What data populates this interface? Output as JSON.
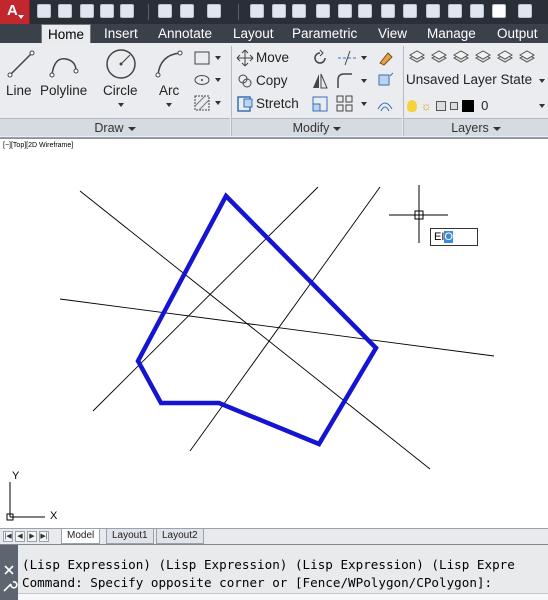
{
  "app": {
    "logo_letter": "A"
  },
  "tabs": [
    {
      "label": "Home",
      "active": true
    },
    {
      "label": "Insert",
      "active": false
    },
    {
      "label": "Annotate",
      "active": false
    },
    {
      "label": "Layout",
      "active": false
    },
    {
      "label": "Parametric",
      "active": false
    },
    {
      "label": "View",
      "active": false
    },
    {
      "label": "Manage",
      "active": false
    },
    {
      "label": "Output",
      "active": false
    }
  ],
  "draw_panel": {
    "title": "Draw",
    "tools": [
      {
        "label": "Line",
        "icon": "line-icon"
      },
      {
        "label": "Polyline",
        "icon": "polyline-icon"
      },
      {
        "label": "Circle",
        "icon": "circle-icon"
      },
      {
        "label": "Arc",
        "icon": "arc-icon"
      }
    ]
  },
  "modify_panel": {
    "title": "Modify",
    "tools": [
      {
        "label": "Move",
        "icon": "move-icon"
      },
      {
        "label": "Copy",
        "icon": "copy-icon"
      },
      {
        "label": "Stretch",
        "icon": "stretch-icon"
      }
    ]
  },
  "layers_panel": {
    "title": "Layers",
    "layer_state": "Unsaved Layer State",
    "current_layer": "0"
  },
  "viewport": {
    "label": "[−][Top][2D Wireframe]",
    "dynamic_input": "EI",
    "dynamic_input_selected": "O"
  },
  "layout_tabs": [
    {
      "label": "Model",
      "active": true
    },
    {
      "label": "Layout1",
      "active": false
    },
    {
      "label": "Layout2",
      "active": false
    }
  ],
  "command": {
    "history": "(Lisp Expression) (Lisp Expression) (Lisp Expression) (Lisp Expre",
    "prompt": "Command: Specify opposite corner or [Fence/WPolygon/CPolygon]:"
  },
  "colors": {
    "polygon": "#1414d2",
    "title_bar": "#2a2f37",
    "app_button": "#c1272d"
  }
}
